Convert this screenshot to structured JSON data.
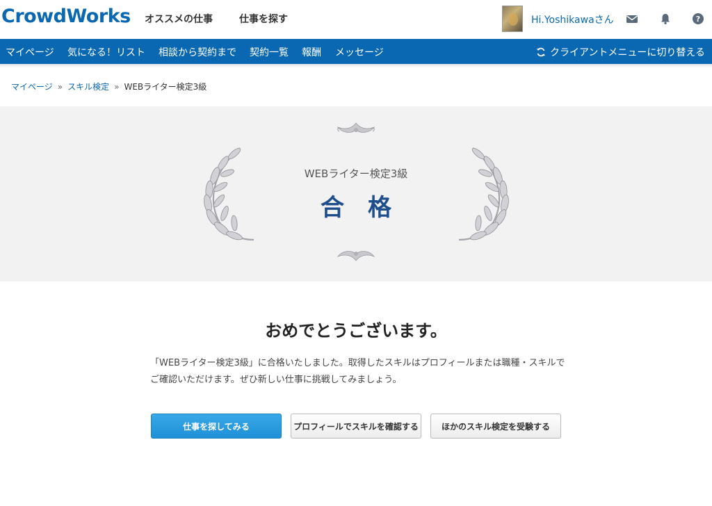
{
  "header": {
    "logo": "CrowdWorks",
    "nav": [
      "オススメの仕事",
      "仕事を探す"
    ],
    "greeting": "Hi.Yoshikawaさん",
    "icons": [
      "mail-icon",
      "bell-icon",
      "help-icon"
    ]
  },
  "subnav": {
    "items": [
      "マイページ",
      "気になる！リスト",
      "相談から契約まで",
      "契約一覧",
      "報酬",
      "メッセージ"
    ],
    "switch_label": "クライアントメニューに切り替える"
  },
  "breadcrumb": {
    "items": [
      "マイページ",
      "スキル検定",
      "WEBライター検定3級"
    ],
    "separator": "»"
  },
  "hero": {
    "subtitle": "WEBライター検定3級",
    "result": "合格"
  },
  "main": {
    "heading": "おめでとうございます。",
    "description": "「WEBライター検定3級」に合格いたしました。取得したスキルはプロフィールまたは職種・スキルでご確認いただけます。ぜひ新しい仕事に挑戦してみましょう。",
    "buttons": [
      "仕事を探してみる",
      "プロフィールでスキルを確認する",
      "ほかのスキル検定を受験する"
    ]
  },
  "colors": {
    "brand": "#0a67b1",
    "result_text": "#1f4e8c",
    "primary_button": "#2a9ce0"
  }
}
